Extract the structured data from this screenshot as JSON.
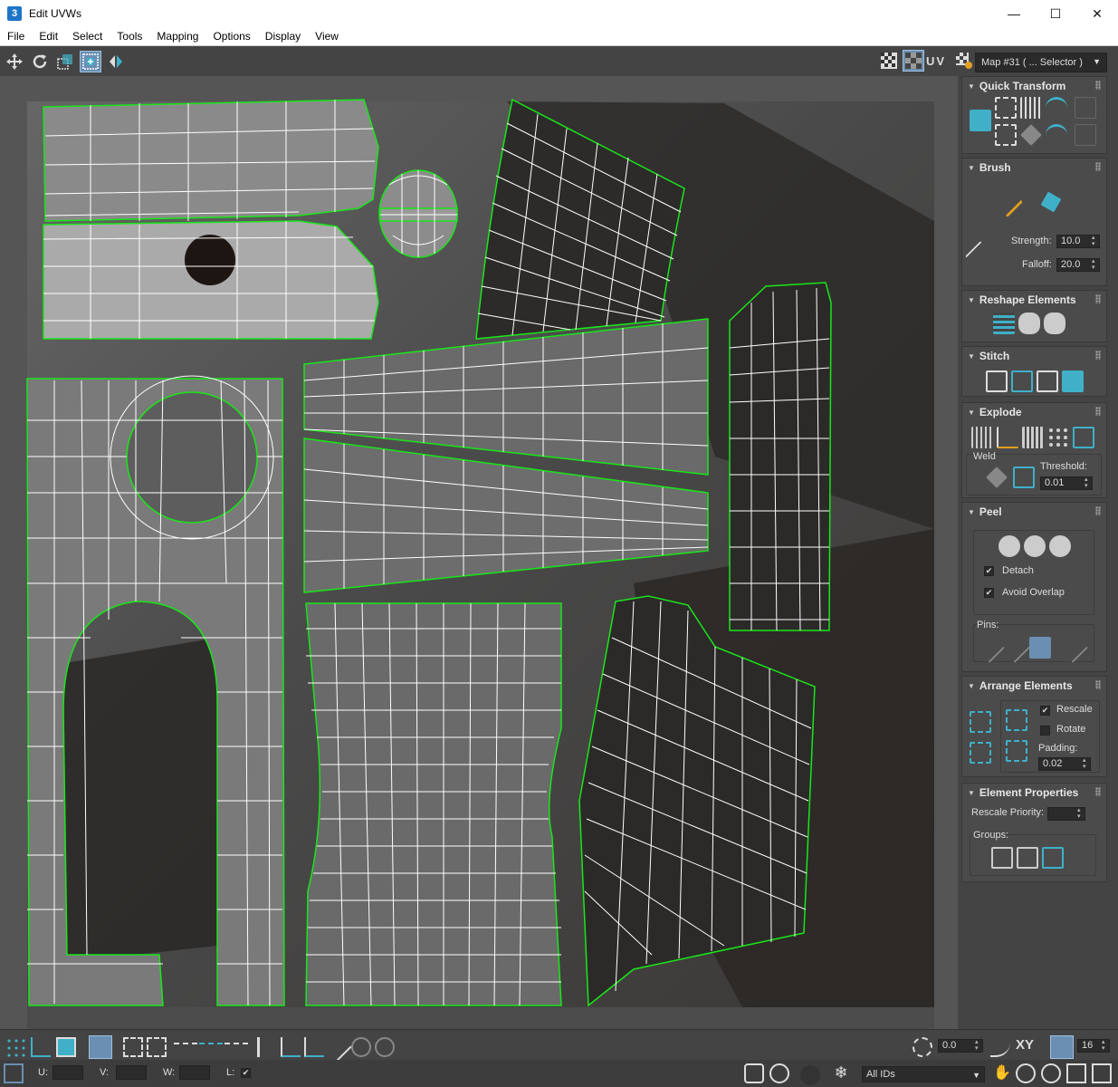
{
  "window": {
    "title": "Edit UVWs",
    "app_icon": "3",
    "minimize": "—",
    "maximize": "☐",
    "close": "✕"
  },
  "menu": [
    "File",
    "Edit",
    "Select",
    "Tools",
    "Mapping",
    "Options",
    "Display",
    "View"
  ],
  "toolbar": {
    "uv_label": "UV",
    "map_selector": "Map #31  ( ... Selector )"
  },
  "panels": {
    "quick_transform": "Quick Transform",
    "brush": {
      "title": "Brush",
      "strength_label": "Strength:",
      "strength": "10.0",
      "falloff_label": "Falloff:",
      "falloff": "20.0"
    },
    "reshape": "Reshape Elements",
    "stitch": "Stitch",
    "explode": {
      "title": "Explode",
      "weld_label": "Weld",
      "threshold_label": "Threshold:",
      "threshold": "0.01"
    },
    "peel": {
      "title": "Peel",
      "detach_label": "Detach",
      "avoid_overlap_label": "Avoid Overlap",
      "pins_label": "Pins:"
    },
    "arrange": {
      "title": "Arrange Elements",
      "rescale_label": "Rescale",
      "rotate_label": "Rotate",
      "padding_label": "Padding:",
      "padding": "0.02"
    },
    "element_props": {
      "title": "Element Properties",
      "rescale_priority_label": "Rescale Priority:",
      "groups_label": "Groups:"
    }
  },
  "status": {
    "u_label": "U:",
    "v_label": "V:",
    "w_label": "W:",
    "l_label": "L:",
    "angle_value": "0.0",
    "xy_label": "XY",
    "grid_value": "16",
    "ids_dropdown": "All IDs"
  },
  "colors": {
    "uv_edge": "#ffffff",
    "uv_border": "#19e619",
    "accent": "#3fb0c8",
    "panel_bg": "#4b4b4b"
  }
}
